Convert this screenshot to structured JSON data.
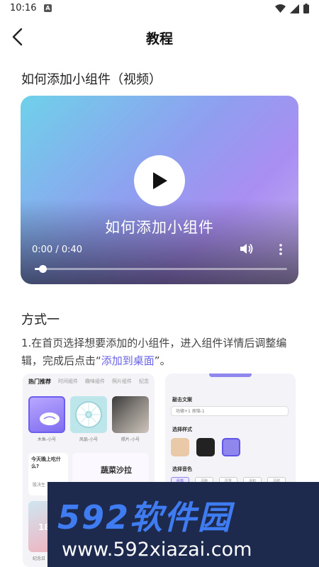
{
  "status": {
    "time": "10:16",
    "app_badge": "A"
  },
  "header": {
    "title": "教程"
  },
  "section1": {
    "title": "如何添加小组件（视频）"
  },
  "video": {
    "caption": "如何添加小组件",
    "time": "0:00 / 0:40",
    "progress": 0.03
  },
  "section2": {
    "title": "方式一"
  },
  "instruction": {
    "text_before": "1.在首页选择想要添加的小组件，进入组件详情后调整编辑，完成后点击“",
    "highlight": "添加到桌面",
    "text_after": "”。"
  },
  "mock1": {
    "tabs": [
      "热门推荐",
      "时间组件",
      "趣味组件",
      "照片组件",
      "纪念"
    ],
    "widgets": [
      "木鱼-小号",
      "风扇-小号",
      "照片-小号"
    ],
    "card_text": "今天晚上吃什么?",
    "salad": "蔬菜沙拉",
    "small_text": "骰决生",
    "badge": "18",
    "footer": "纪念日"
  },
  "mock2": {
    "label_text": "敲击文案",
    "input_value": "功德+1 烦恼-1",
    "label_style": "选择样式",
    "label_color": "选择音色",
    "chips": [
      "经典",
      "清脆",
      "厚重",
      "温和",
      "清越"
    ]
  },
  "watermark": {
    "main": "592软件园",
    "url": "www.592xiazai.com"
  },
  "colors": {
    "accent": "#6a63e8",
    "watermark_bg": "#1d2a4d",
    "watermark_blue": "#3f7cf2"
  }
}
